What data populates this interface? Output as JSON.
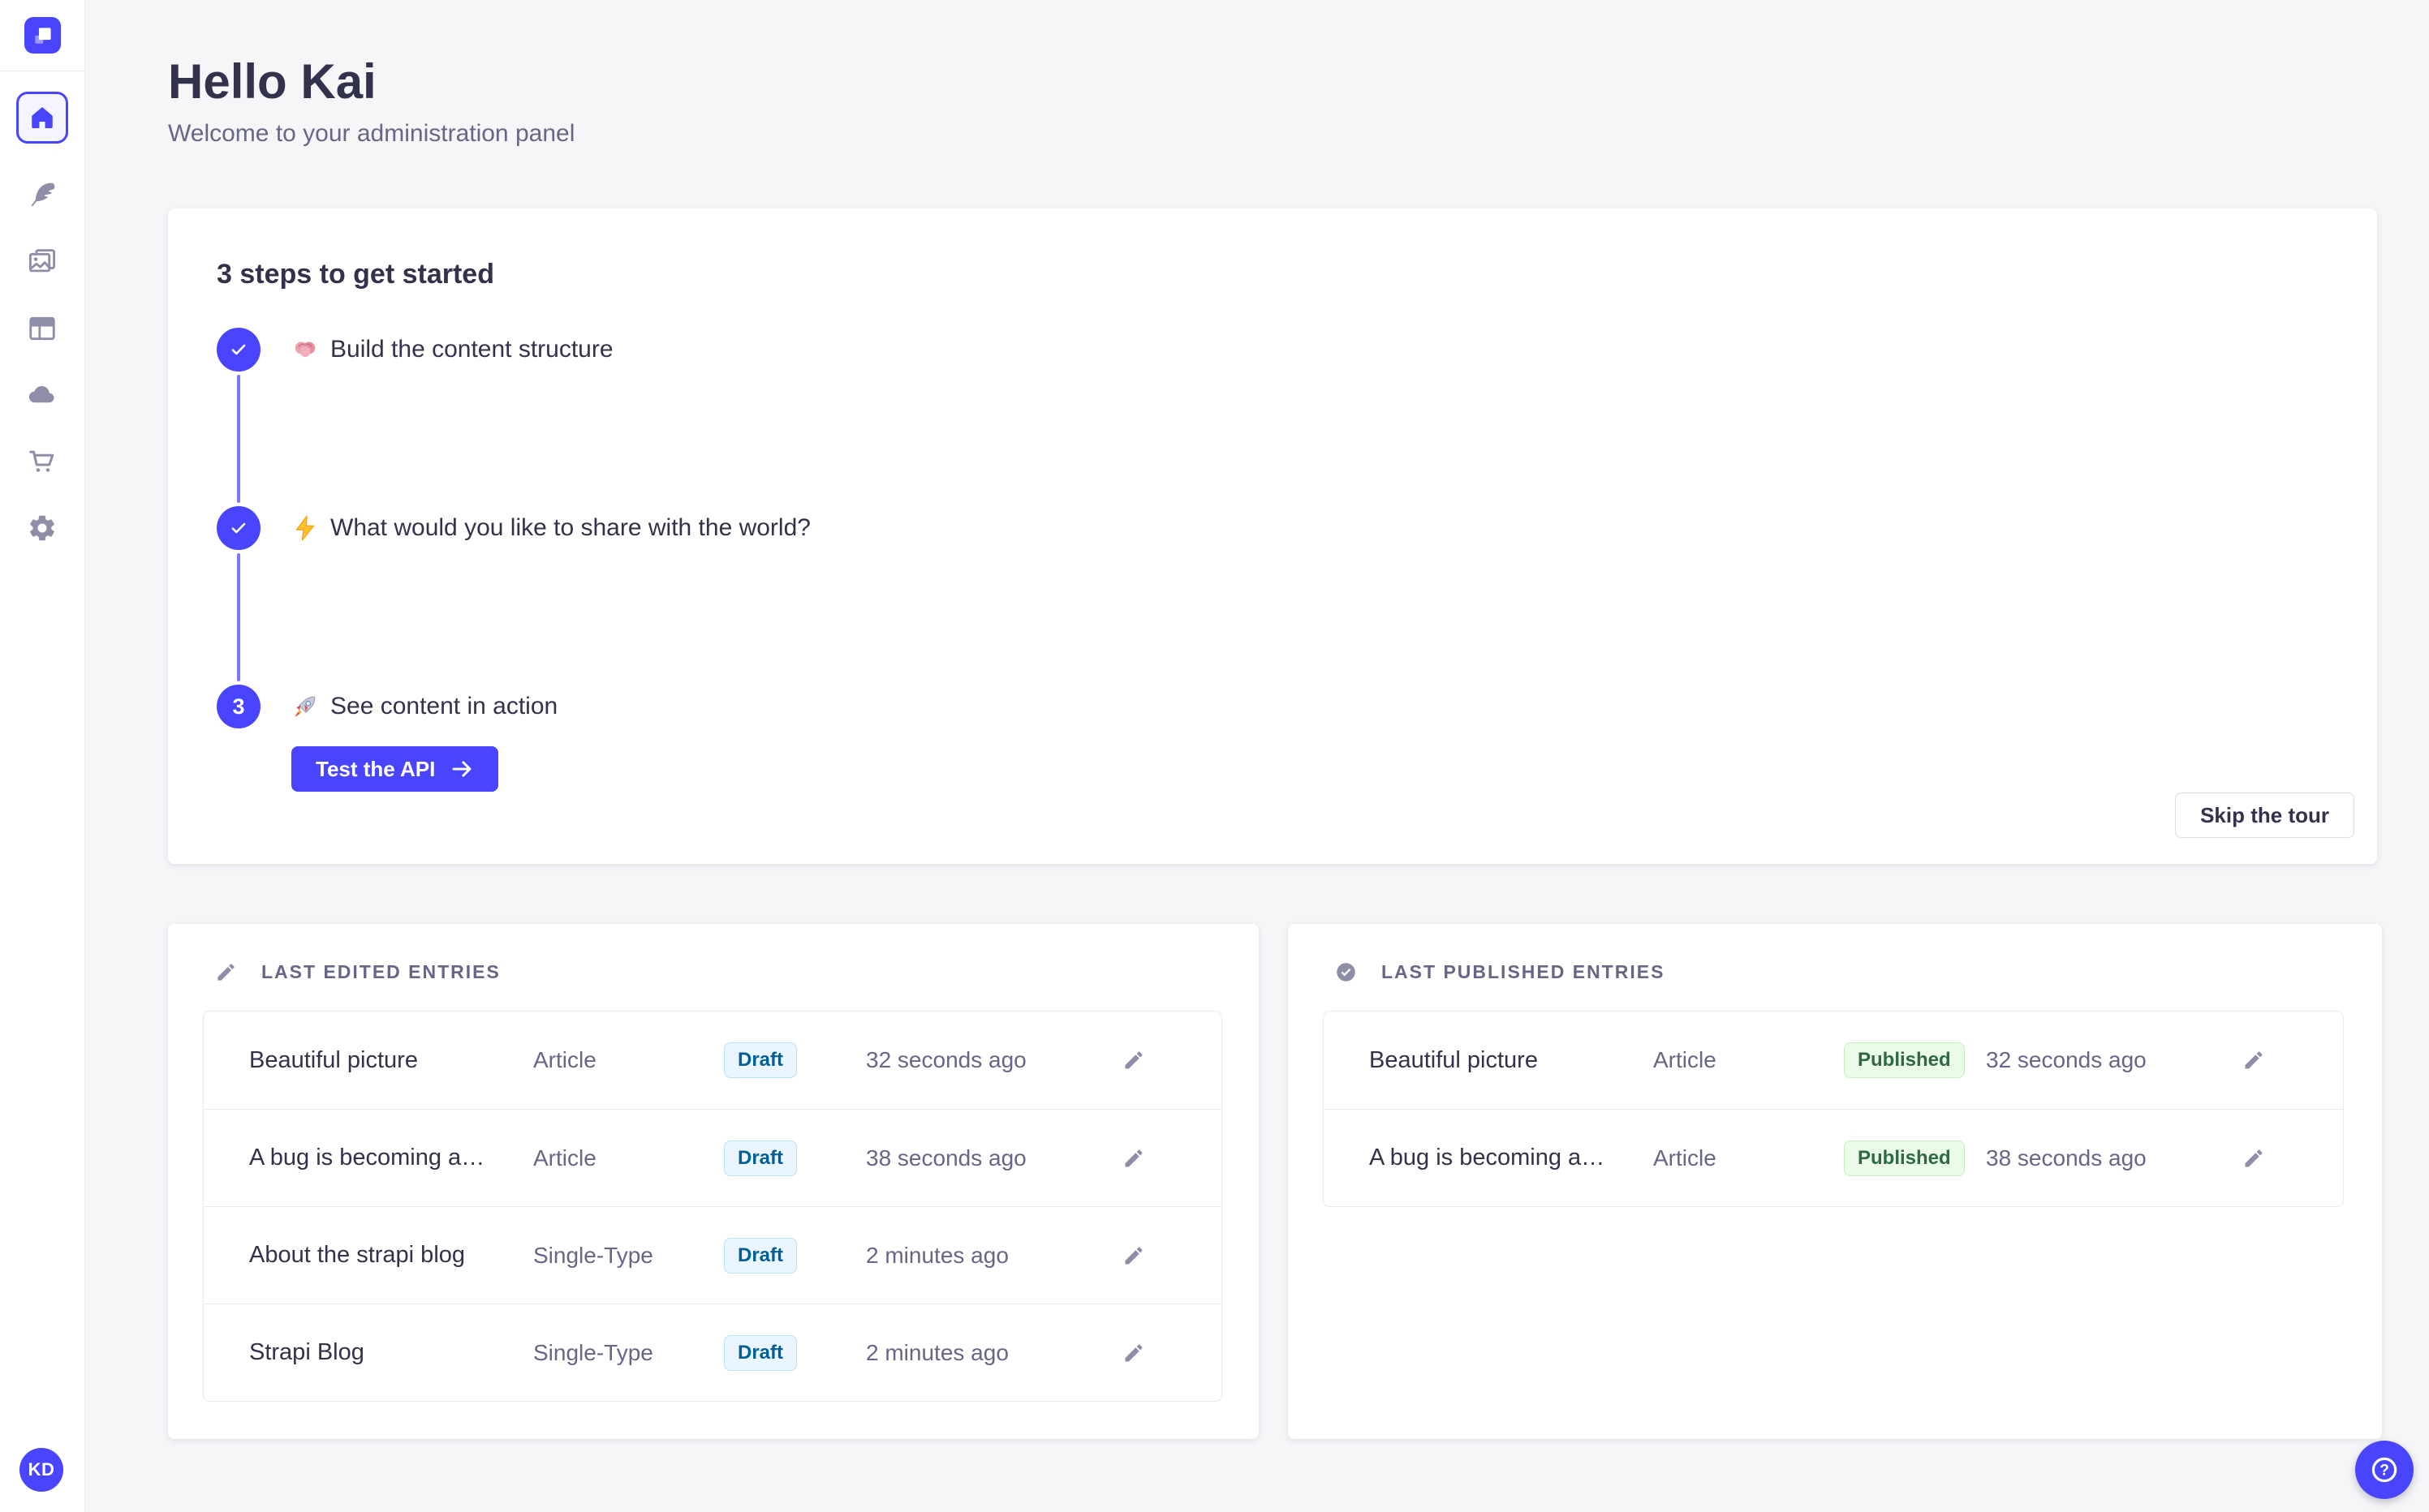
{
  "sidebar": {
    "logo_icon": "strapi-logo",
    "nav": [
      {
        "id": "home",
        "icon": "home-icon",
        "active": true
      },
      {
        "id": "content-type-builder",
        "icon": "feather-icon",
        "active": false
      },
      {
        "id": "media-library",
        "icon": "images-icon",
        "active": false
      },
      {
        "id": "content-manager",
        "icon": "layout-icon",
        "active": false
      },
      {
        "id": "deploy",
        "icon": "cloud-icon",
        "active": false
      },
      {
        "id": "marketplace",
        "icon": "cart-icon",
        "active": false
      },
      {
        "id": "settings",
        "icon": "gear-icon",
        "active": false
      }
    ],
    "avatar_initials": "KD"
  },
  "header": {
    "title": "Hello Kai",
    "subtitle": "Welcome to your administration panel"
  },
  "onboarding": {
    "title": "3 steps to get started",
    "steps": [
      {
        "number": 1,
        "status": "done",
        "emoji": "🧠",
        "emoji_icon": "brain-icon",
        "label": "Build the content structure"
      },
      {
        "number": 2,
        "status": "done",
        "emoji": "⚡",
        "emoji_icon": "bolt-icon",
        "label": "What would you like to share with the world?"
      },
      {
        "number": 3,
        "status": "current",
        "emoji": "🚀",
        "emoji_icon": "rocket-icon",
        "label": "See content in action",
        "action_label": "Test the API",
        "action_icon": "arrow-right-icon"
      }
    ],
    "skip_label": "Skip the tour"
  },
  "last_edited": {
    "title": "LAST EDITED ENTRIES",
    "icon": "pencil-icon",
    "rows": [
      {
        "name": "Beautiful picture",
        "type": "Article",
        "status": "Draft",
        "time": "32 seconds ago"
      },
      {
        "name": "A bug is becoming a…",
        "type": "Article",
        "status": "Draft",
        "time": "38 seconds ago"
      },
      {
        "name": "About the strapi blog",
        "type": "Single-Type",
        "status": "Draft",
        "time": "2 minutes ago"
      },
      {
        "name": "Strapi Blog",
        "type": "Single-Type",
        "status": "Draft",
        "time": "2 minutes ago"
      }
    ]
  },
  "last_published": {
    "title": "LAST PUBLISHED ENTRIES",
    "icon": "check-circle-icon",
    "rows": [
      {
        "name": "Beautiful picture",
        "type": "Article",
        "status": "Published",
        "time": "32 seconds ago"
      },
      {
        "name": "A bug is becoming a…",
        "type": "Article",
        "status": "Published",
        "time": "38 seconds ago"
      }
    ]
  },
  "help": {
    "icon": "question-icon"
  },
  "colors": {
    "accent": "#4945FF",
    "accent_light": "#7B79FF",
    "page_background": "#F6F6F9",
    "card_background": "#FFFFFF",
    "border": "#EAEAEF",
    "text_primary": "#32324D",
    "text_secondary": "#666687",
    "icon_gray": "#8E8EA9",
    "draft_bg": "#EAF5FF",
    "draft_border": "#B8E1FF",
    "draft_text": "#006096",
    "published_bg": "#EAFBE7",
    "published_border": "#C6F0C2",
    "published_text": "#2F6846"
  }
}
